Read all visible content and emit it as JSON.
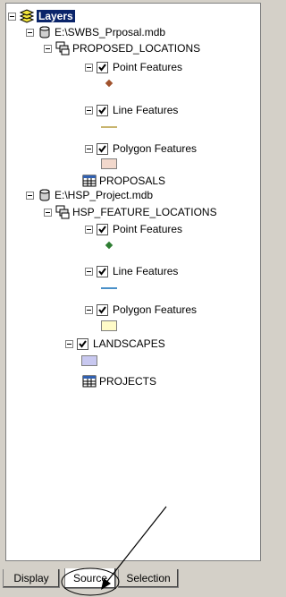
{
  "toc": {
    "root": {
      "label": "Layers",
      "icon": "layers-icon"
    },
    "databases": [
      {
        "path": "E:\\SWBS_Prposal.mdb",
        "icon": "database-icon",
        "dataset": "PROPOSED_LOCATIONS",
        "layers": [
          {
            "label": "Point Features",
            "checked": true,
            "symbol": "point",
            "color": "#a0522d"
          },
          {
            "label": "Line Features",
            "checked": true,
            "symbol": "line",
            "color": "#c8b46e"
          },
          {
            "label": "Polygon Features",
            "checked": true,
            "symbol": "polygon",
            "color": "#f2d8cc"
          }
        ],
        "table": "PROPOSALS"
      },
      {
        "path": "E:\\HSP_Project.mdb",
        "icon": "database-icon",
        "dataset": "HSP_FEATURE_LOCATIONS",
        "layers": [
          {
            "label": "Point Features",
            "checked": true,
            "symbol": "point",
            "color": "#2e7d32"
          },
          {
            "label": "Line Features",
            "checked": true,
            "symbol": "line",
            "color": "#4a90c8"
          },
          {
            "label": "Polygon Features",
            "checked": true,
            "symbol": "polygon",
            "color": "#fffbc8"
          }
        ],
        "extra_layer": {
          "label": "LANDSCAPES",
          "checked": true,
          "symbol": "polygon",
          "color": "#c8c8f0"
        },
        "table": "PROJECTS"
      }
    ]
  },
  "tabs": [
    {
      "label": "Display",
      "active": false
    },
    {
      "label": "Source",
      "active": true
    },
    {
      "label": "Selection",
      "active": false
    }
  ],
  "colors": {
    "selection": "#0a246a",
    "panel_bg": "#ffffff",
    "chrome_bg": "#d4d0c8"
  }
}
